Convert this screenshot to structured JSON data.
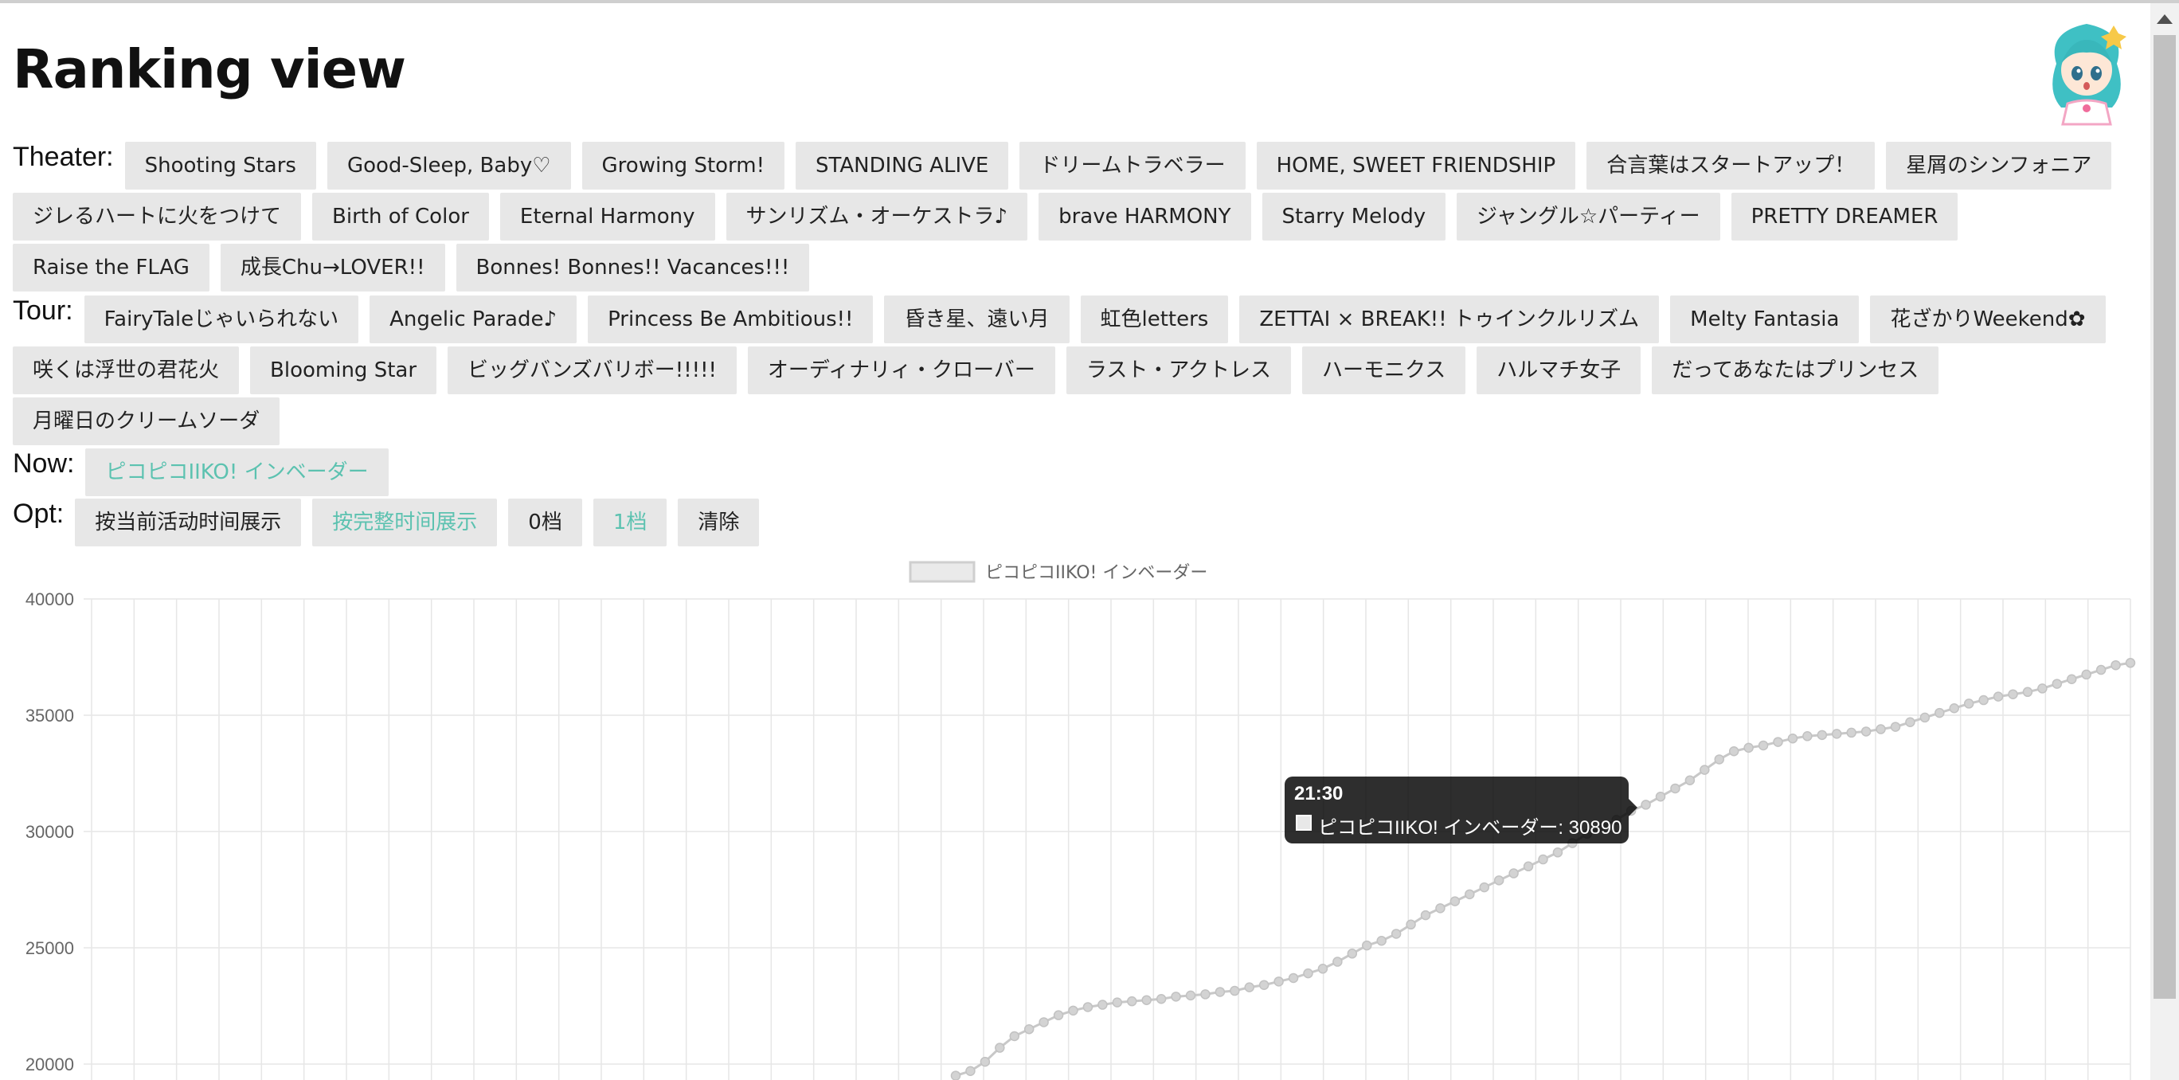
{
  "page": {
    "title": "Ranking view"
  },
  "theater": {
    "label": "Theater:",
    "items": [
      "Shooting Stars",
      "Good-Sleep, Baby♡",
      "Growing Storm!",
      "STANDING ALIVE",
      "ドリームトラベラー",
      "HOME, SWEET FRIENDSHIP",
      "合言葉はスタートアップ！",
      "星屑のシンフォニア",
      "ジレるハートに火をつけて",
      "Birth of Color",
      "Eternal Harmony",
      "サンリズム・オーケストラ♪",
      "brave HARMONY",
      "Starry Melody",
      "ジャングル☆パーティー",
      "PRETTY DREAMER",
      "Raise the FLAG",
      "成長Chu→LOVER!!",
      "Bonnes! Bonnes!! Vacances!!!"
    ]
  },
  "tour": {
    "label": "Tour:",
    "items": [
      "FairyTaleじゃいられない",
      "Angelic Parade♪",
      "Princess Be Ambitious!!",
      "昏き星、遠い月",
      "虹色letters",
      "ZETTAI × BREAK!! トゥインクルリズム",
      "Melty Fantasia",
      "花ざかりWeekend✿",
      "咲くは浮世の君花火",
      "Blooming Star",
      "ビッグバンズバリボー!!!!!",
      "オーディナリィ・クローバー",
      "ラスト・アクトレス",
      "ハーモニクス",
      "ハルマチ女子",
      "だってあなたはプリンセス",
      "月曜日のクリームソーダ"
    ]
  },
  "now": {
    "label": "Now:",
    "items": [
      "ピコピコIIKO! インベーダー"
    ]
  },
  "opt": {
    "label": "Opt:",
    "items": [
      "按当前活动时间展示",
      "按完整时间展示",
      "0档",
      "1档",
      "清除"
    ],
    "active": [
      false,
      true,
      false,
      true,
      false
    ]
  },
  "colors": {
    "accent": "#5cc2b0",
    "button_bg": "#e7e7e7",
    "series": "#c8c8c8",
    "grid": "#e6e6e6"
  },
  "avatar": {
    "icon": "chibi-character-avatar"
  },
  "chart_data": {
    "type": "line",
    "title": "",
    "xlabel": "",
    "ylabel": "",
    "legend": "top-center",
    "grid": true,
    "ylim": [
      20000,
      40000
    ],
    "yticks": [
      40000,
      35000,
      30000,
      25000,
      20000
    ],
    "series": [
      {
        "name": "ピコピコIIKO! インベーダー",
        "values": [
          19500,
          19700,
          20100,
          20700,
          21200,
          21500,
          21800,
          22100,
          22300,
          22450,
          22550,
          22650,
          22700,
          22750,
          22800,
          22900,
          22950,
          23000,
          23100,
          23150,
          23300,
          23400,
          23550,
          23700,
          23900,
          24100,
          24400,
          24750,
          25100,
          25300,
          25600,
          26000,
          26400,
          26700,
          27000,
          27300,
          27600,
          27900,
          28200,
          28500,
          28800,
          29100,
          29500,
          29900,
          30200,
          30500,
          30890,
          31150,
          31500,
          31850,
          32200,
          32650,
          33100,
          33450,
          33600,
          33700,
          33850,
          34000,
          34100,
          34150,
          34200,
          34250,
          34300,
          34400,
          34500,
          34700,
          34900,
          35100,
          35300,
          35500,
          35650,
          35800,
          35900,
          36000,
          36150,
          36350,
          36550,
          36750,
          36950,
          37150,
          37250
        ]
      }
    ],
    "tooltip": {
      "title": "21:30",
      "text": "ピコピコIIKO! インベーダー: 30890"
    }
  }
}
